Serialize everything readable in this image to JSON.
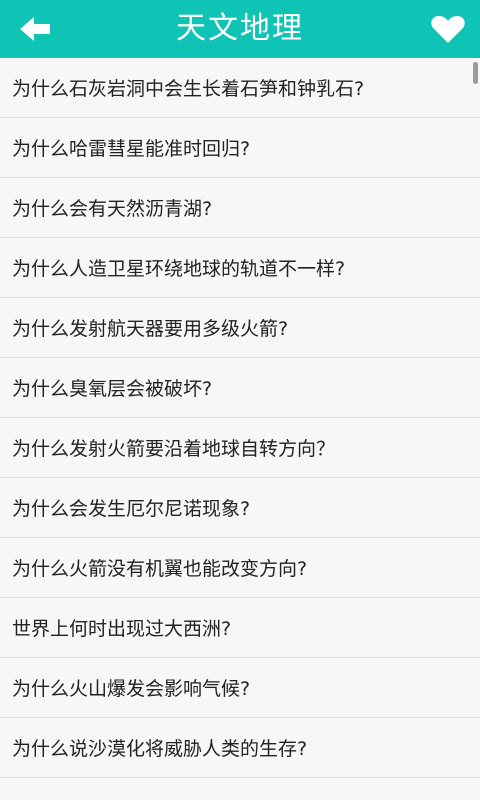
{
  "header": {
    "title": "天文地理",
    "back_icon": "arrow-left-icon",
    "favorite_icon": "heart-icon",
    "accent_color": "#0fc3b5"
  },
  "list": {
    "items": [
      {
        "label": "为什么石灰岩洞中会生长着石笋和钟乳石?"
      },
      {
        "label": "为什么哈雷彗星能准时回归?"
      },
      {
        "label": "为什么会有天然沥青湖?"
      },
      {
        "label": "为什么人造卫星环绕地球的轨道不一样?"
      },
      {
        "label": "为什么发射航天器要用多级火箭?"
      },
      {
        "label": "为什么臭氧层会被破坏?"
      },
      {
        "label": "为什么发射火箭要沿着地球自转方向？"
      },
      {
        "label": "为什么会发生厄尔尼诺现象?"
      },
      {
        "label": "为什么火箭没有机翼也能改变方向?"
      },
      {
        "label": "世界上何时出现过大西洲?"
      },
      {
        "label": "为什么火山爆发会影响气候?"
      },
      {
        "label": "为什么说沙漠化将威胁人类的生存?"
      },
      {
        "label": ""
      }
    ]
  }
}
